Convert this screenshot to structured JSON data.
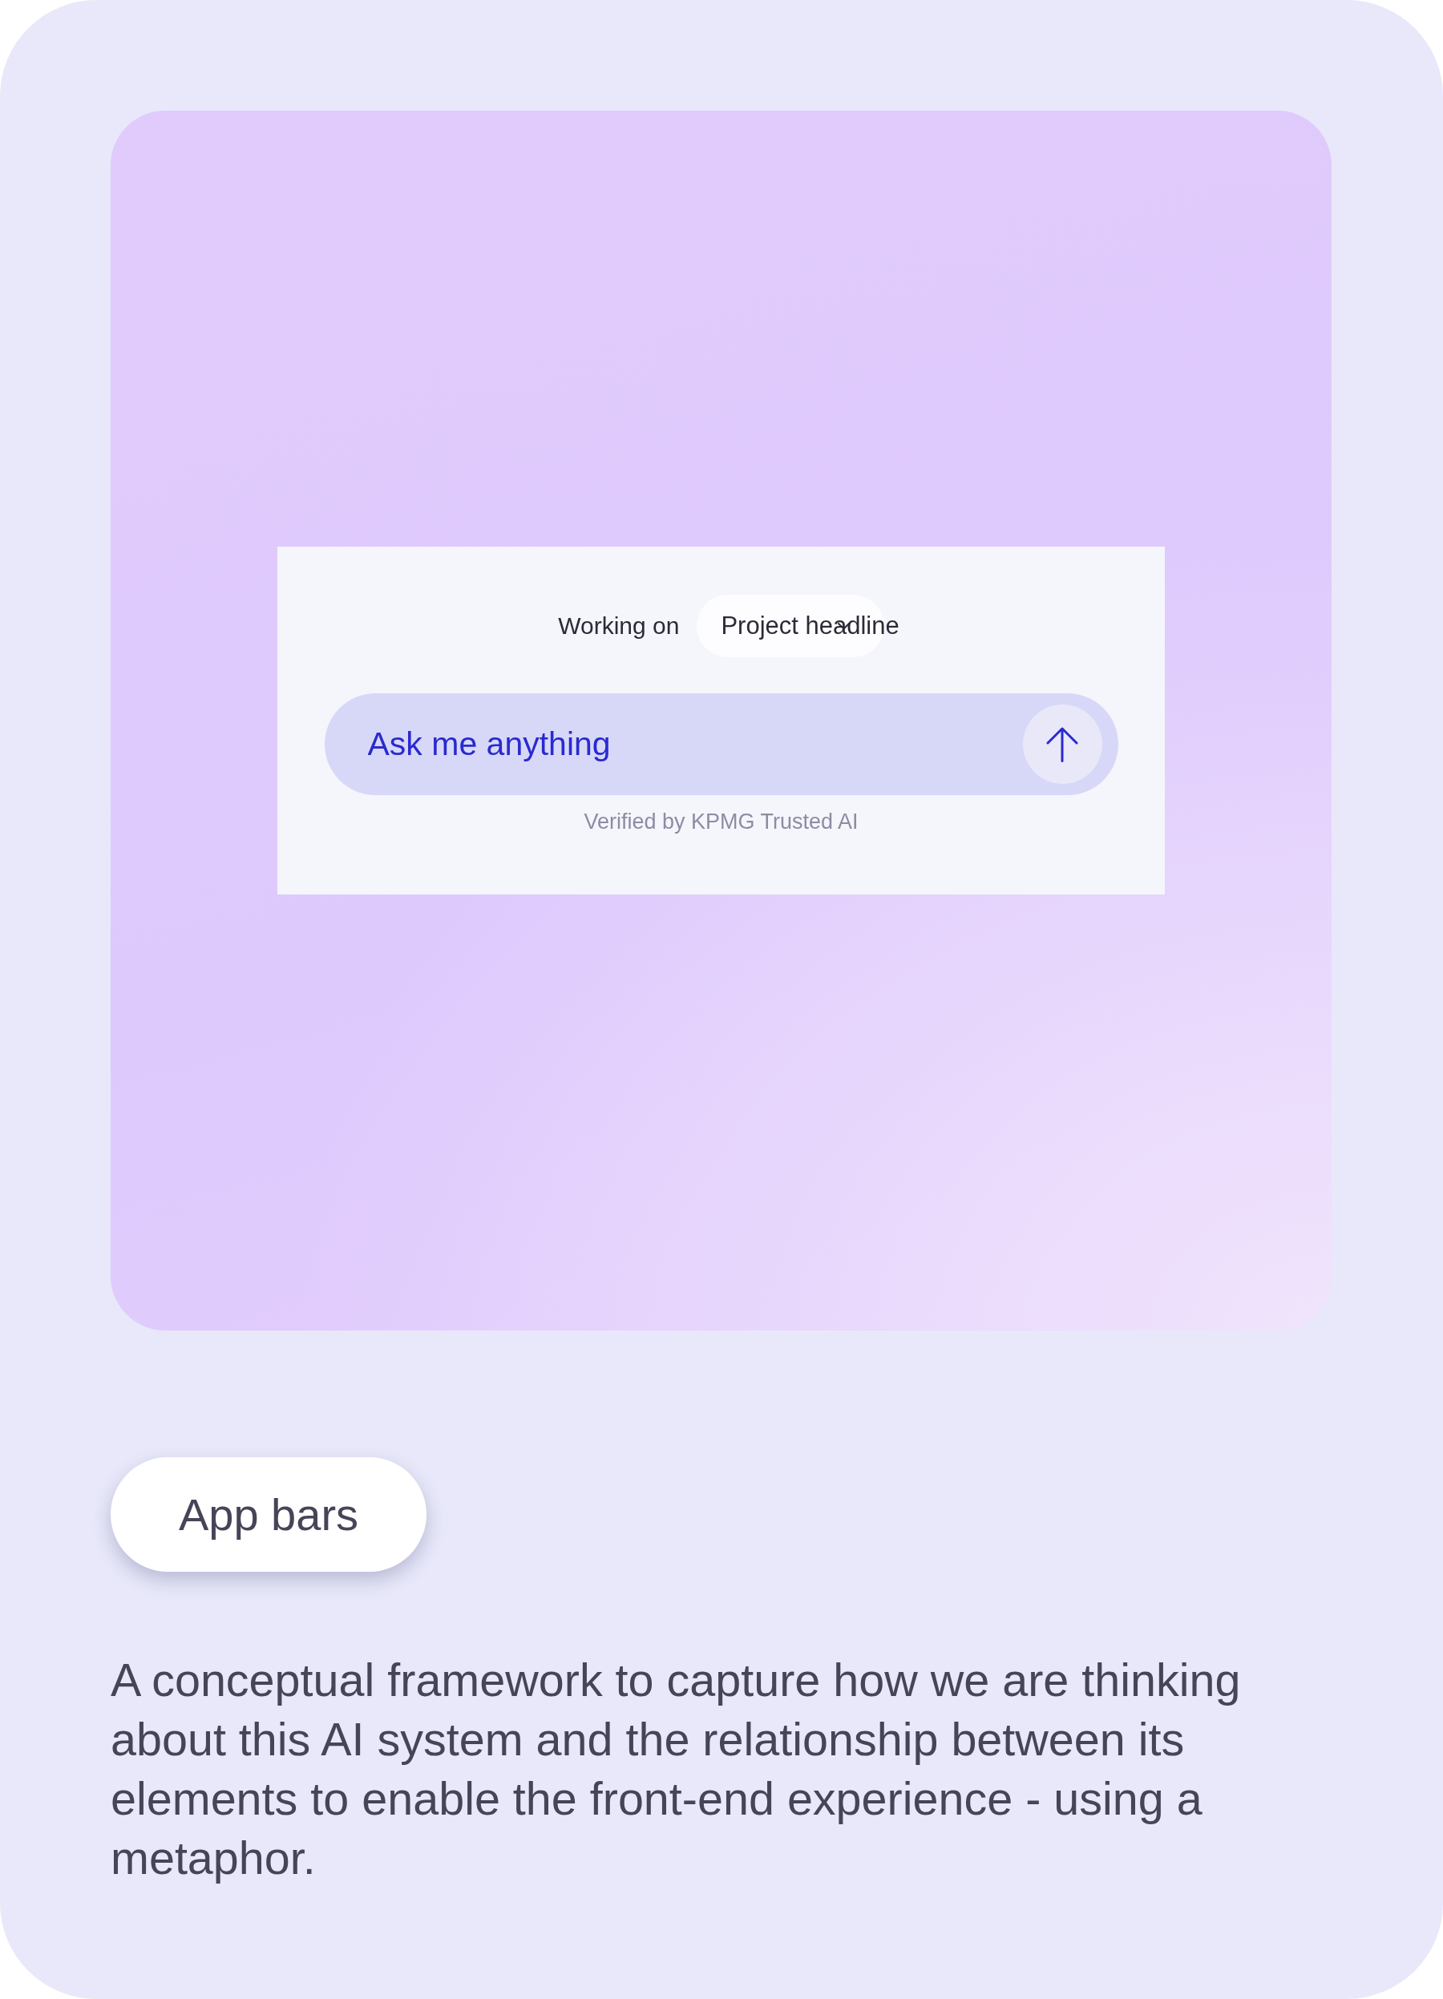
{
  "preview": {
    "context": {
      "label": "Working on",
      "project": "Project headline"
    },
    "prompt": {
      "placeholder": "Ask me anything"
    },
    "footnote": "Verified by KPMG Trusted AI"
  },
  "category": "App bars",
  "description": "A conceptual framework to capture how we are thinking about this AI system and the relationship between its elements to enable the front-end experience - using a metaphor."
}
